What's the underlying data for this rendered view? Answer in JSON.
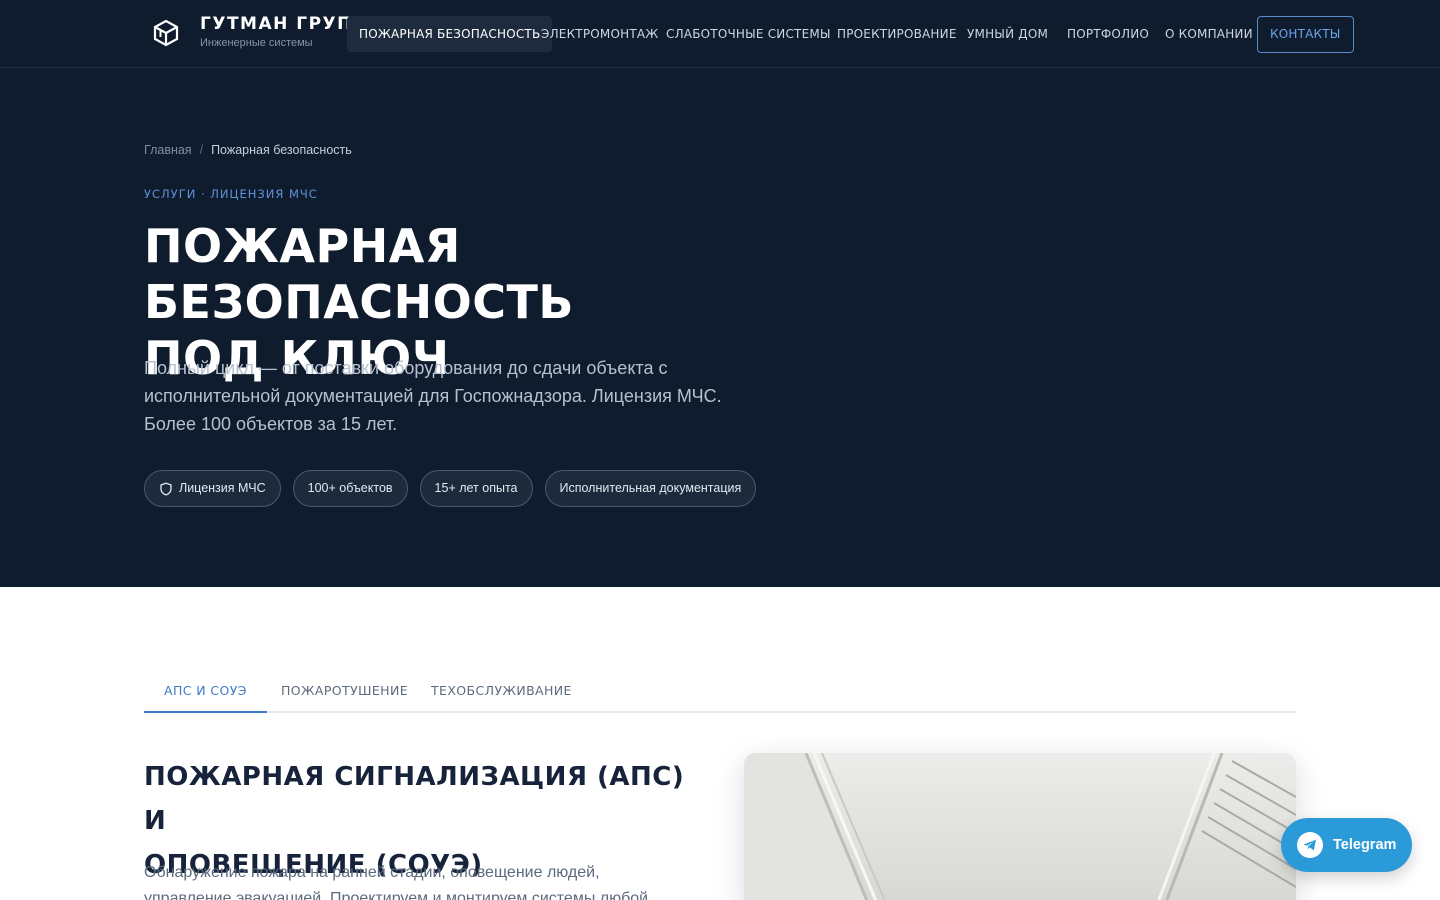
{
  "header": {
    "brand_name": "ГУТМАН ГРУПП",
    "brand_sub": "Инженерные системы",
    "nav": [
      "ПОЖАРНАЯ БЕЗОПАСНОСТЬ",
      "ЭЛЕКТРОМОНТАЖ",
      "СЛАБОТОЧНЫЕ СИСТЕМЫ",
      "ПРОЕКТИРОВАНИЕ",
      "УМНЫЙ ДОМ",
      "ПОРТФОЛИО",
      "О КОМПАНИИ",
      "КОНТАКТЫ"
    ],
    "active_nav": "ПОЖАРНАЯ БЕЗОПАСНОСТЬ"
  },
  "hero": {
    "breadcrumb": {
      "home": "Главная",
      "separator": "/",
      "current": "Пожарная безопасность"
    },
    "eyebrow": "УСЛУГИ · ЛИЦЕНЗИЯ МЧС",
    "title_line1": "ПОЖАРНАЯ БЕЗОПАСНОСТЬ",
    "title_line2": "ПОД КЛЮЧ",
    "description": "Полный цикл — от поставки оборудования до сдачи объекта с исполнительной документацией для Госпожнадзора. Лицензия МЧС. Более 100 объектов за 15 лет.",
    "badges": [
      {
        "label": "Лицензия МЧС",
        "icon": "shield-icon"
      },
      {
        "label": "100+ объектов"
      },
      {
        "label": "15+ лет опыта"
      },
      {
        "label": "Исполнительная документация"
      }
    ]
  },
  "tabs": {
    "items": [
      "АПС И СОУЭ",
      "ПОЖАРОТУШЕНИЕ",
      "ТЕХОБСЛУЖИВАНИЕ"
    ],
    "active": "АПС И СОУЭ"
  },
  "section": {
    "title_line1": "ПОЖАРНАЯ СИГНАЛИЗАЦИЯ (АПС) И",
    "title_line2": "ОПОВЕЩЕНИЕ (СОУЭ)",
    "description": "Обнаружение пожара на ранней стадии, оповещение людей, управление эвакуацией. Проектируем и монтируем системы любой сложности — от"
  },
  "floating": {
    "telegram_label": "Telegram",
    "icon": "telegram-icon"
  },
  "colors": {
    "dark_bg": "#0f1c2e",
    "accent": "#3f7ac4",
    "telegram": "#2a9bd8"
  }
}
